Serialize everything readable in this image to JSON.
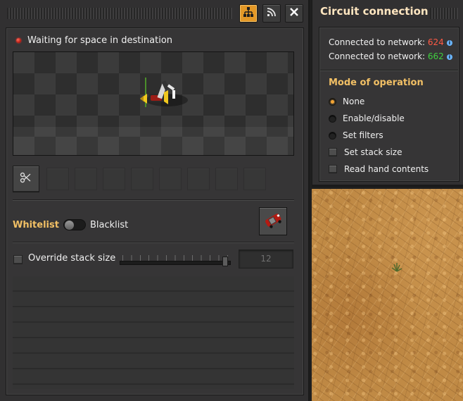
{
  "main_window": {
    "title_buttons": [
      {
        "icon": "network-tree-icon",
        "active": true
      },
      {
        "icon": "wireless-signal-icon",
        "active": false
      },
      {
        "icon": "close-icon",
        "active": false
      }
    ],
    "status": {
      "indicator_color": "#e0261a",
      "text": "Waiting for space in destination"
    },
    "filters": {
      "slot_count": 9,
      "primary_slot_icon": "filter-scissors-icon"
    },
    "mode": {
      "whitelist_label": "Whitelist",
      "blacklist_label": "Blacklist",
      "selected": "Whitelist",
      "item_icon": "car-icon"
    },
    "override": {
      "label": "Override stack size",
      "checked": false,
      "value": "12"
    }
  },
  "circuit": {
    "title": "Circuit connection",
    "networks": [
      {
        "label": "Connected to network:",
        "id": "624",
        "color": "#ff5a45"
      },
      {
        "label": "Connected to network:",
        "id": "662",
        "color": "#3fcf3f"
      }
    ],
    "mode_title": "Mode of operation",
    "options": [
      {
        "label": "None",
        "type": "radio",
        "selected": true
      },
      {
        "label": "Enable/disable",
        "type": "radio",
        "selected": false
      },
      {
        "label": "Set filters",
        "type": "radio",
        "selected": false
      },
      {
        "label": "Set stack size",
        "type": "checkbox",
        "selected": false
      },
      {
        "label": "Read hand contents",
        "type": "checkbox",
        "selected": false
      }
    ]
  },
  "colors": {
    "accent_orange": "#e39827",
    "heading_yellow": "#f2c065",
    "panel_bg": "#313031",
    "sand": "#c08a45"
  }
}
